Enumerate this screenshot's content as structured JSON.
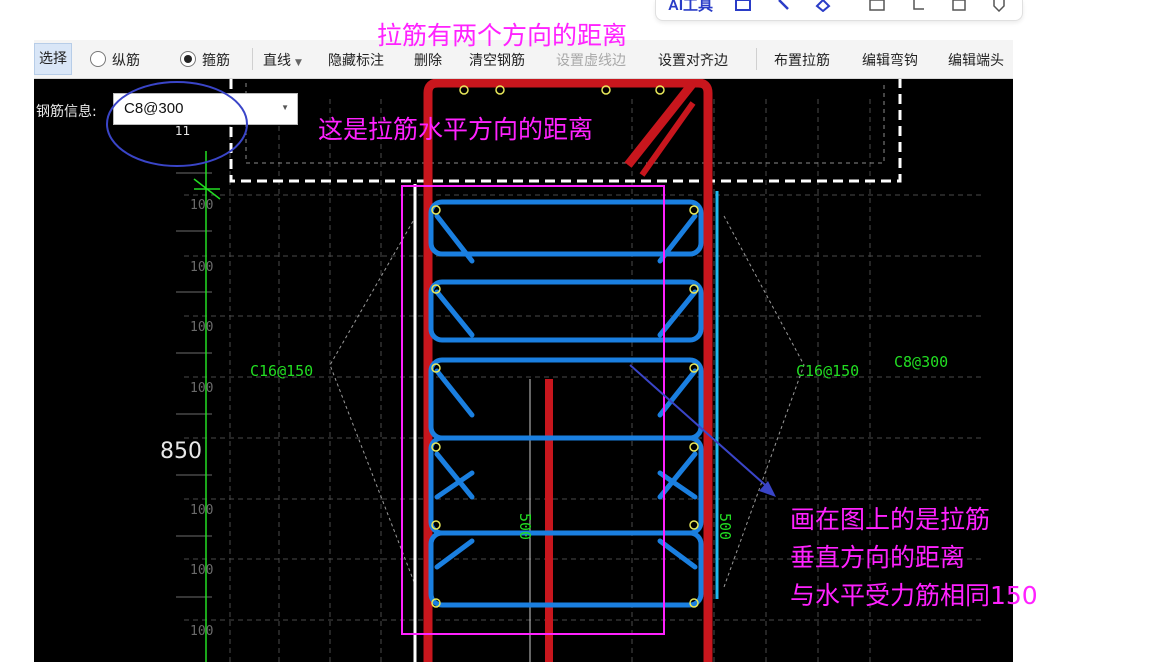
{
  "floating_toolbar": {
    "partial_text": "AI工具"
  },
  "toolbar": {
    "select_label": "选择",
    "radio_longitudinal": "纵筋",
    "radio_stirrup": "箍筋",
    "line_label": "直线",
    "hide_annotation": "隐藏标注",
    "delete": "删除",
    "clear_rebar": "清空钢筋",
    "set_dashed_edge": "设置虚线边",
    "set_align_edge": "设置对齐边",
    "place_tie_bar": "布置拉筋",
    "edit_hook": "编辑弯钩",
    "edit_end": "编辑端头"
  },
  "rebar_info": {
    "label": "钢筋信息:",
    "value": "C8@300"
  },
  "drawing": {
    "left_label": "C16@150",
    "right_label": "C16@150",
    "right_label_2": "C8@300",
    "dimension_850": "850",
    "dim_500_left": "500",
    "dim_500_right": "500",
    "spacing_label": "100",
    "partial_top_label": "11"
  },
  "annotations": {
    "top_title": "拉筋有两个方向的距离",
    "horizontal_note": "这是拉筋水平方向的距离",
    "vertical_note_line1": "画在图上的是拉筋",
    "vertical_note_line2": "垂直方向的距离",
    "vertical_note_line3": "与水平受力筋相同150"
  },
  "colors": {
    "annotation_magenta": "#ff22ff",
    "stirrup_blue": "#1a7fe0",
    "main_bar_red": "#c8161d",
    "dimension_green": "#22dd22",
    "circle_marker_blue": "#3a45c8",
    "canvas_black": "#000000"
  }
}
